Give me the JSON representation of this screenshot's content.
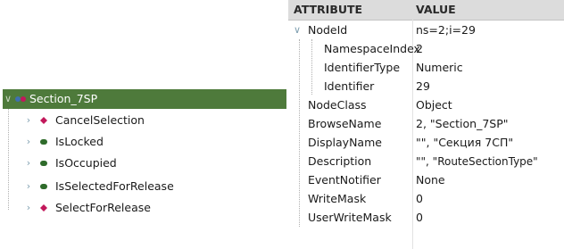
{
  "tree": {
    "root": {
      "label": "Section_7SP",
      "chevron": "chevron-down-icon",
      "icon": "object-node-icon"
    },
    "children": [
      {
        "label": "CancelSelection",
        "kind": "method",
        "icon": "method-icon"
      },
      {
        "label": "IsLocked",
        "kind": "variable",
        "icon": "variable-icon"
      },
      {
        "label": "IsOccupied",
        "kind": "variable",
        "icon": "variable-icon"
      },
      {
        "label": "IsSelectedForRelease",
        "kind": "variable",
        "icon": "variable-icon"
      },
      {
        "label": "SelectForRelease",
        "kind": "method",
        "icon": "method-icon"
      }
    ]
  },
  "attributes": {
    "header": {
      "attribute": "ATTRIBUTE",
      "value": "VALUE"
    },
    "rows": [
      {
        "name": "NodeId",
        "value": "ns=2;i=29",
        "expandable": true
      },
      {
        "name": "NamespaceIndex",
        "value": "2",
        "child": true
      },
      {
        "name": "IdentifierType",
        "value": "Numeric",
        "child": true
      },
      {
        "name": "Identifier",
        "value": "29",
        "child": true
      },
      {
        "name": "NodeClass",
        "value": "Object"
      },
      {
        "name": "BrowseName",
        "value": "2, \"Section_7SP\""
      },
      {
        "name": "DisplayName",
        "value": "\"\", \"Секция 7СП\""
      },
      {
        "name": "Description",
        "value": "\"\", \"RouteSectionType\""
      },
      {
        "name": "EventNotifier",
        "value": "None"
      },
      {
        "name": "WriteMask",
        "value": "0"
      },
      {
        "name": "UserWriteMask",
        "value": "0"
      }
    ]
  },
  "colors": {
    "selection": "#4e7a3b",
    "method_icon": "#c2185b",
    "variable_icon": "#2e6b2a",
    "object_icon": "#3f6fb0",
    "header_bg": "#dcdcdc"
  }
}
